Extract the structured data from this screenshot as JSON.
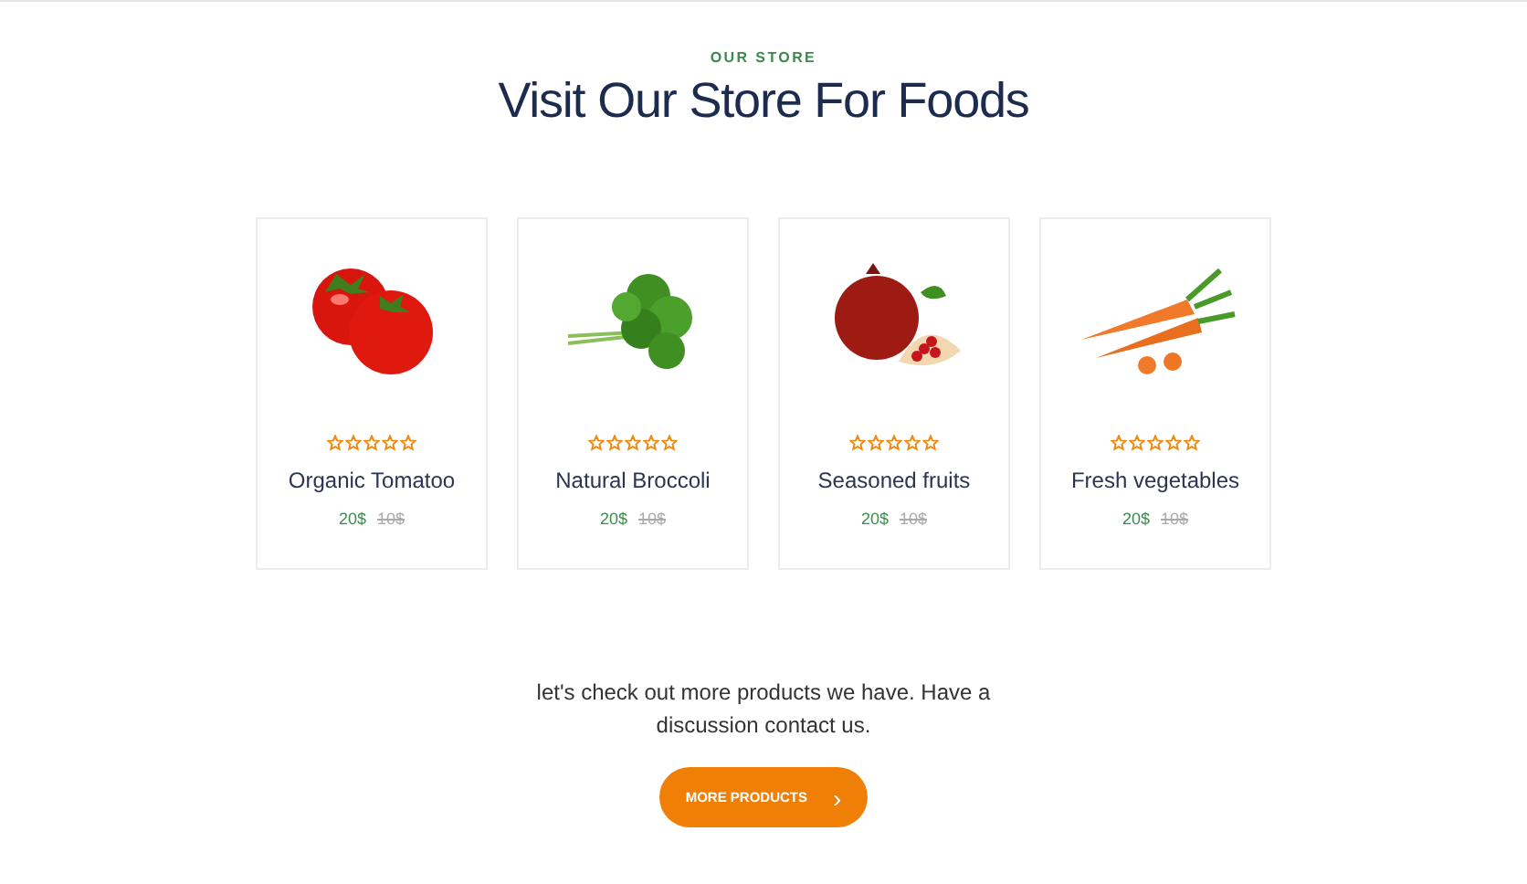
{
  "section": {
    "eyebrow": "OUR STORE",
    "title": "Visit Our Store For Foods"
  },
  "products": [
    {
      "kind": "tomato",
      "stars": 0,
      "name": "Organic Tomatoo",
      "price": "20$",
      "old_price": "10$"
    },
    {
      "kind": "herb",
      "stars": 0,
      "name": "Natural Broccoli",
      "price": "20$",
      "old_price": "10$"
    },
    {
      "kind": "pomegranate",
      "stars": 0,
      "name": "Seasoned fruits",
      "price": "20$",
      "old_price": "10$"
    },
    {
      "kind": "carrot",
      "stars": 0,
      "name": "Fresh vegetables",
      "price": "20$",
      "old_price": "10$"
    }
  ],
  "footer": {
    "text": "let's check out more products we have. Have a discussion contact us.",
    "button": "MORE PRODUCTS",
    "button_icon": "›"
  }
}
